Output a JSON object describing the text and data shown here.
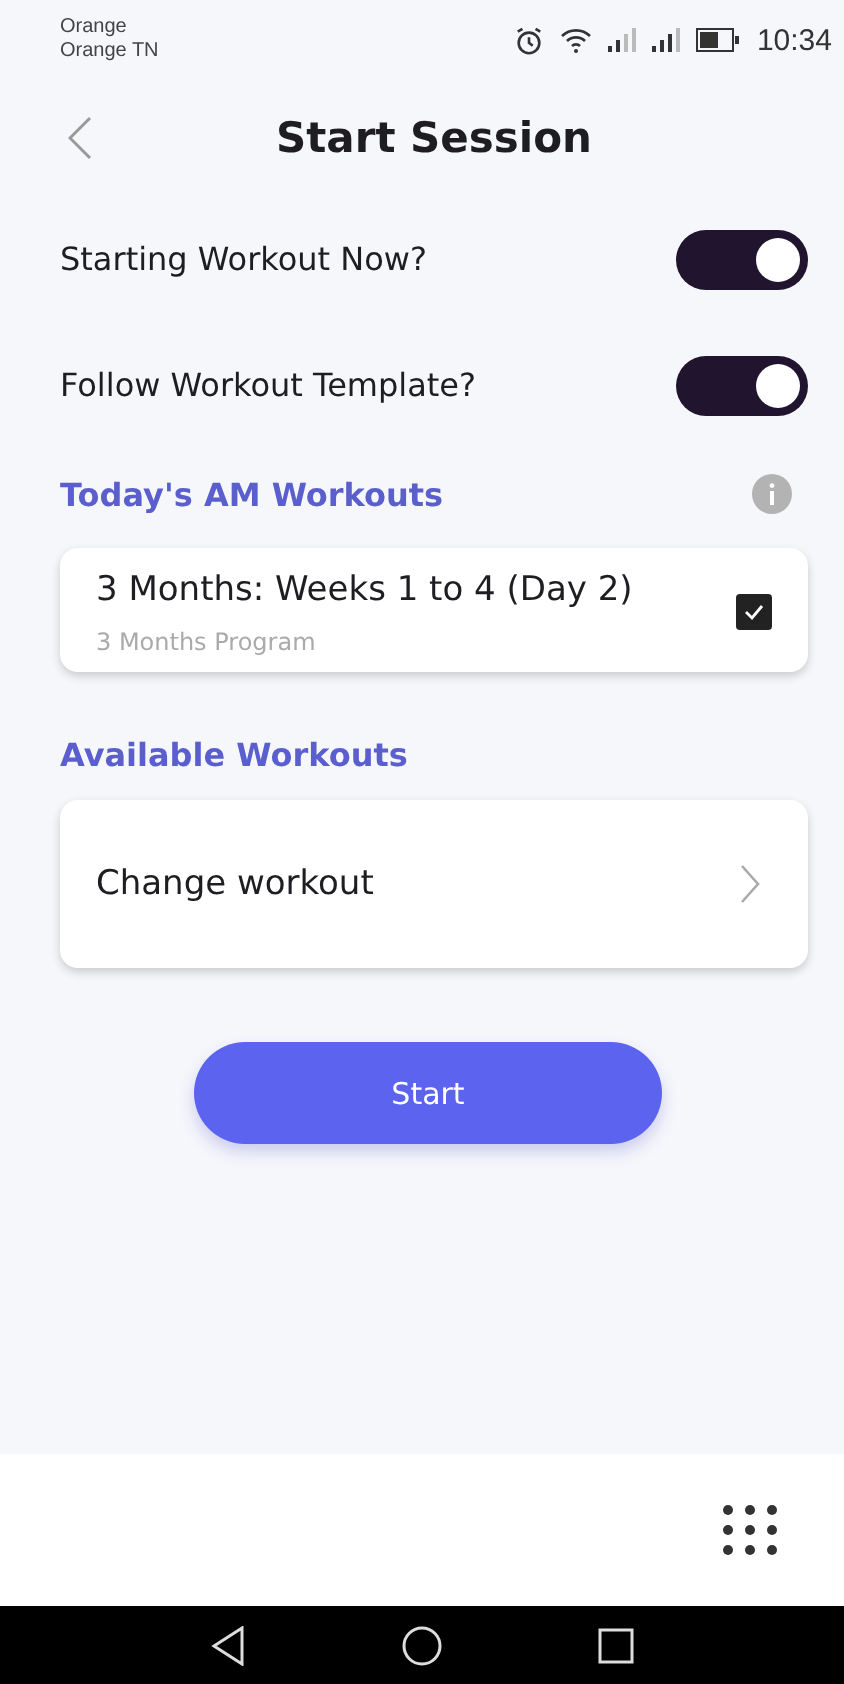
{
  "status_bar": {
    "carrier": "Orange",
    "network": "Orange TN",
    "time": "10:34"
  },
  "header": {
    "title": "Start Session"
  },
  "toggles": [
    {
      "label": "Starting Workout Now?",
      "on": true
    },
    {
      "label": "Follow Workout Template?",
      "on": true
    }
  ],
  "todays_section": {
    "title": "Today's AM Workouts"
  },
  "todays_workouts": [
    {
      "title": "3 Months: Weeks 1 to 4 (Day 2)",
      "program": "3 Months Program",
      "checked": true
    }
  ],
  "available_section": {
    "title": "Available Workouts"
  },
  "change_workout": {
    "label": "Change workout"
  },
  "start_button": {
    "label": "Start"
  }
}
